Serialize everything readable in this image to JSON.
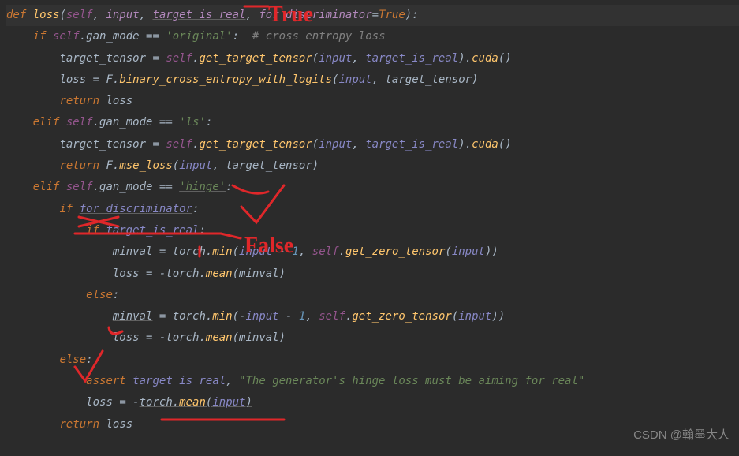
{
  "annotations": {
    "true_label": "True",
    "false_label": "False"
  },
  "watermark": "CSDN @翰墨大人",
  "code": {
    "l0": {
      "def": "def ",
      "fn": "loss",
      "p": "(",
      "self": "self",
      "c1": ", ",
      "a1": "input",
      "c2": ", ",
      "a2": "target_is_real",
      "c3": ", ",
      "a3": "for_discriminator",
      "eq": "=",
      "tr": "True",
      "pp": "):"
    },
    "l1": {
      "ind": "    ",
      "if": "if ",
      "self": "self",
      "d": ".gan_mode ",
      "op": "== ",
      "s": "'original'",
      "col": ":",
      "sp": "  ",
      "cmt": "# cross entropy loss"
    },
    "l2": {
      "ind": "        ",
      "v": "target_tensor ",
      "eq": "= ",
      "self": "self",
      "d": ".",
      "fn": "get_target_tensor",
      "p": "(",
      "a1": "input",
      "c": ", ",
      "a2": "target_is_real",
      "pp": ").",
      "fn2": "cuda",
      "pp2": "()"
    },
    "l3": {
      "ind": "        ",
      "v": "loss ",
      "eq": "= ",
      "m": "F.",
      "fn": "binary_cross_entropy_with_logits",
      "p": "(",
      "a1": "input",
      "c": ", ",
      "a2": "target_tensor)"
    },
    "l4": {
      "ind": "        ",
      "ret": "return ",
      "v": "loss"
    },
    "l5": {
      "ind": "    ",
      "elif": "elif ",
      "self": "self",
      "d": ".gan_mode ",
      "op": "== ",
      "s": "'ls'",
      "col": ":"
    },
    "l6": {
      "ind": "        ",
      "v": "target_tensor ",
      "eq": "= ",
      "self": "self",
      "d": ".",
      "fn": "get_target_tensor",
      "p": "(",
      "a1": "input",
      "c": ", ",
      "a2": "target_is_real",
      "pp": ").",
      "fn2": "cuda",
      "pp2": "()"
    },
    "l7": {
      "ind": "        ",
      "ret": "return ",
      "m": "F.",
      "fn": "mse_loss",
      "p": "(",
      "a1": "input",
      "c": ", ",
      "a2": "target_tensor)"
    },
    "l8": {
      "ind": "    ",
      "elif": "elif ",
      "self": "self",
      "d": ".gan_mode ",
      "op": "== ",
      "s": "'hinge'",
      "col": ":"
    },
    "l9": {
      "ind": "        ",
      "if": "if ",
      "a": "for_discriminator",
      "col": ":"
    },
    "l10": {
      "ind": "            ",
      "if": "if ",
      "a": "target_is_real",
      "col": ":"
    },
    "l11": {
      "ind": "                ",
      "v": "minval",
      "sp": " ",
      "eq": "= ",
      "m": "torch.",
      "fn": "min",
      "p": "(",
      "a1": "input",
      "op": " - ",
      "n": "1",
      "c": ", ",
      "self": "self",
      "d": ".",
      "fn2": "get_zero_tensor",
      "p2": "(",
      "a2": "input",
      "pp": "))"
    },
    "l12": {
      "ind": "                ",
      "v": "loss ",
      "eq": "= -",
      "m": "torch.",
      "fn": "mean",
      "p": "(minval)"
    },
    "l13": {
      "ind": "            ",
      "else": "else",
      "col": ":"
    },
    "l14": {
      "ind": "                ",
      "v": "minval",
      "sp": " ",
      "eq": "= ",
      "m": "torch.",
      "fn": "min",
      "p": "(-",
      "a1": "input",
      "op": " - ",
      "n": "1",
      "c": ", ",
      "self": "self",
      "d": ".",
      "fn2": "get_zero_tensor",
      "p2": "(",
      "a2": "input",
      "pp": "))"
    },
    "l15": {
      "ind": "                ",
      "v": "loss ",
      "eq": "= -",
      "m": "torch.",
      "fn": "mean",
      "p": "(minval)"
    },
    "l16": {
      "ind": "        ",
      "else": "else",
      "col": ":"
    },
    "l17": {
      "ind": "            ",
      "assert": "assert ",
      "a": "target_is_real",
      "c": ", ",
      "s": "\"The generator's hinge loss must be aiming for real\""
    },
    "l18": {
      "ind": "            ",
      "v": "loss ",
      "eq": "= -",
      "m": "torch.",
      "fn": "mean",
      "p": "(",
      "a1": "input",
      "pp": ")"
    },
    "l19": {
      "ind": "        ",
      "ret": "return ",
      "v": "loss"
    }
  }
}
